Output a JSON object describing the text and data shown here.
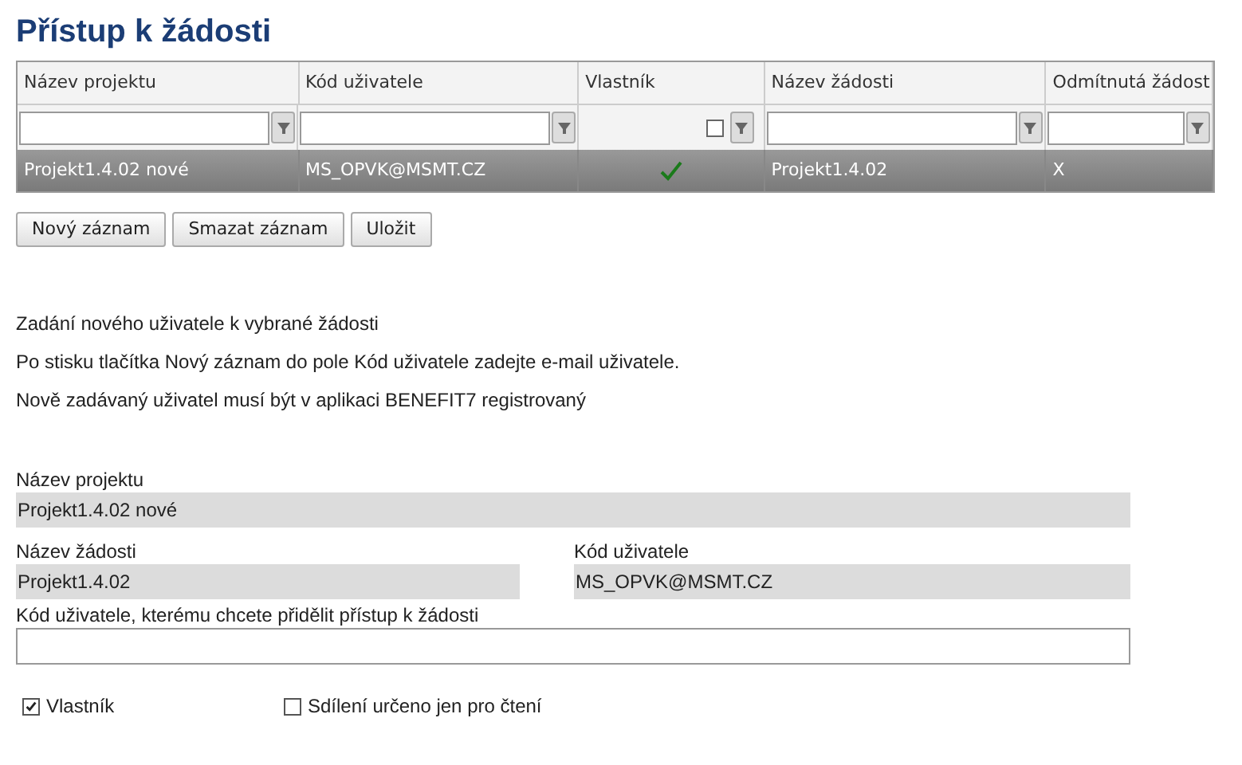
{
  "title": "Přístup k žádosti",
  "table": {
    "columns": [
      {
        "label": "Název projektu",
        "kind": "text"
      },
      {
        "label": "Kód uživatele",
        "kind": "text"
      },
      {
        "label": "Vlastník",
        "kind": "checkbox",
        "filter_checked": false
      },
      {
        "label": "Název žádosti",
        "kind": "text"
      },
      {
        "label": "Odmítnutá žádost",
        "kind": "text"
      }
    ],
    "rows": [
      {
        "selected": true,
        "project": "Projekt1.4.02 nové",
        "user": "MS_OPVK@MSMT.CZ",
        "owner": true,
        "request": "Projekt1.4.02",
        "rejected": "X"
      }
    ]
  },
  "buttons": [
    "Nový záznam",
    "Smazat záznam",
    "Uložit"
  ],
  "info": [
    "Zadání nového uživatele k vybrané žádosti",
    "Po stisku tlačítka Nový záznam do pole Kód uživatele zadejte e-mail uživatele.",
    "Nově zadávaný uživatel musí být v aplikaci BENEFIT7 registrovaný"
  ],
  "form": {
    "project": {
      "label": "Název projektu",
      "value": "Projekt1.4.02 nové"
    },
    "request": {
      "label": "Název žádosti",
      "value": "Projekt1.4.02"
    },
    "user": {
      "label": "Kód uživatele",
      "value": "MS_OPVK@MSMT.CZ"
    },
    "new_user": {
      "label": "Kód uživatele, kterému chcete přidělit přístup k žádosti"
    },
    "checkboxes": [
      {
        "label": "Vlastník",
        "checked": true
      },
      {
        "label": "Sdílení určeno jen pro čtení",
        "checked": false
      }
    ]
  }
}
